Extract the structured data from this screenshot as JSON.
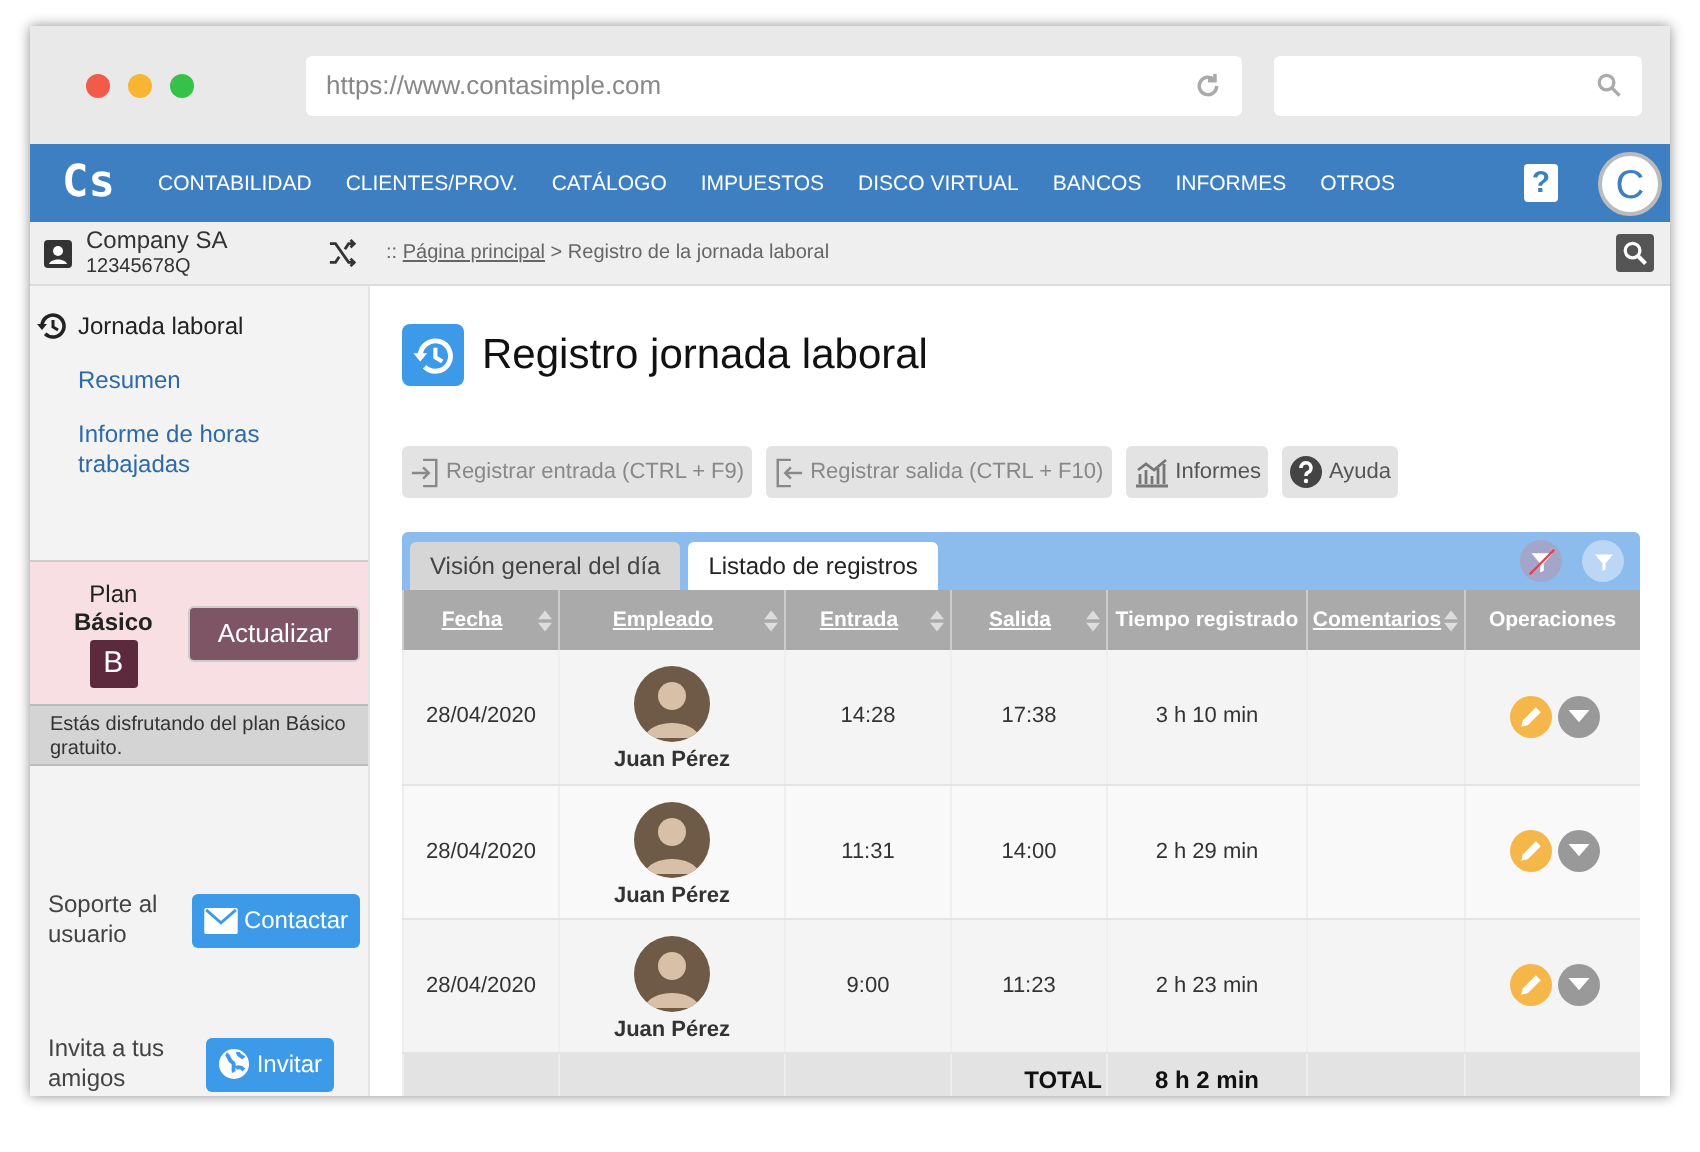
{
  "browser": {
    "url": "https://www.contasimple.com"
  },
  "nav": {
    "logo": "Cs",
    "items": [
      "CONTABILIDAD",
      "CLIENTES/PROV.",
      "CATÁLOGO",
      "IMPUESTOS",
      "DISCO VIRTUAL",
      "BANCOS",
      "INFORMES",
      "OTROS"
    ],
    "help": "?",
    "profile": "C"
  },
  "company": {
    "name": "Company SA",
    "id": "12345678Q"
  },
  "breadcrumb": {
    "prefix": "::",
    "link": "Página principal",
    "rest": "> Registro de la jornada laboral"
  },
  "sidebar": {
    "section": "Jornada laboral",
    "links": [
      "Resumen",
      "Informe de horas trabajadas"
    ],
    "plan": {
      "label": "Plan",
      "name": "Básico",
      "badge": "B",
      "button": "Actualizar",
      "note": "Estás disfrutando del plan Básico gratuito."
    },
    "support": {
      "label": "Soporte al usuario",
      "button": "Contactar"
    },
    "invite": {
      "label": "Invita a tus amigos",
      "button": "Invitar"
    }
  },
  "page": {
    "title": "Registro jornada laboral",
    "actions": [
      {
        "kind": "enter",
        "label": "Registrar entrada (CTRL + F9)"
      },
      {
        "kind": "exit",
        "label": "Registrar salida (CTRL + F10)"
      },
      {
        "kind": "reports",
        "label": "Informes"
      },
      {
        "kind": "help",
        "label": "Ayuda"
      }
    ],
    "tabs": [
      {
        "label": "Visión general del día",
        "selected": false
      },
      {
        "label": "Listado de registros",
        "selected": true
      }
    ]
  },
  "table": {
    "columns": [
      {
        "label": "Fecha",
        "sortable": true
      },
      {
        "label": "Empleado",
        "sortable": true
      },
      {
        "label": "Entrada",
        "sortable": true
      },
      {
        "label": "Salida",
        "sortable": true
      },
      {
        "label": "Tiempo registrado",
        "sortable": false
      },
      {
        "label": "Comentarios",
        "sortable": true
      },
      {
        "label": "Operaciones",
        "sortable": false
      }
    ],
    "rows": [
      {
        "date": "28/04/2020",
        "employee": "Juan Pérez",
        "in": "14:28",
        "out": "17:38",
        "time": "3 h 10 min"
      },
      {
        "date": "28/04/2020",
        "employee": "Juan Pérez",
        "in": "11:31",
        "out": "14:00",
        "time": "2 h 29 min"
      },
      {
        "date": "28/04/2020",
        "employee": "Juan Pérez",
        "in": "9:00",
        "out": "11:23",
        "time": "2 h 23 min"
      }
    ],
    "total": {
      "label": "TOTAL",
      "value": "8 h 2 min"
    }
  }
}
